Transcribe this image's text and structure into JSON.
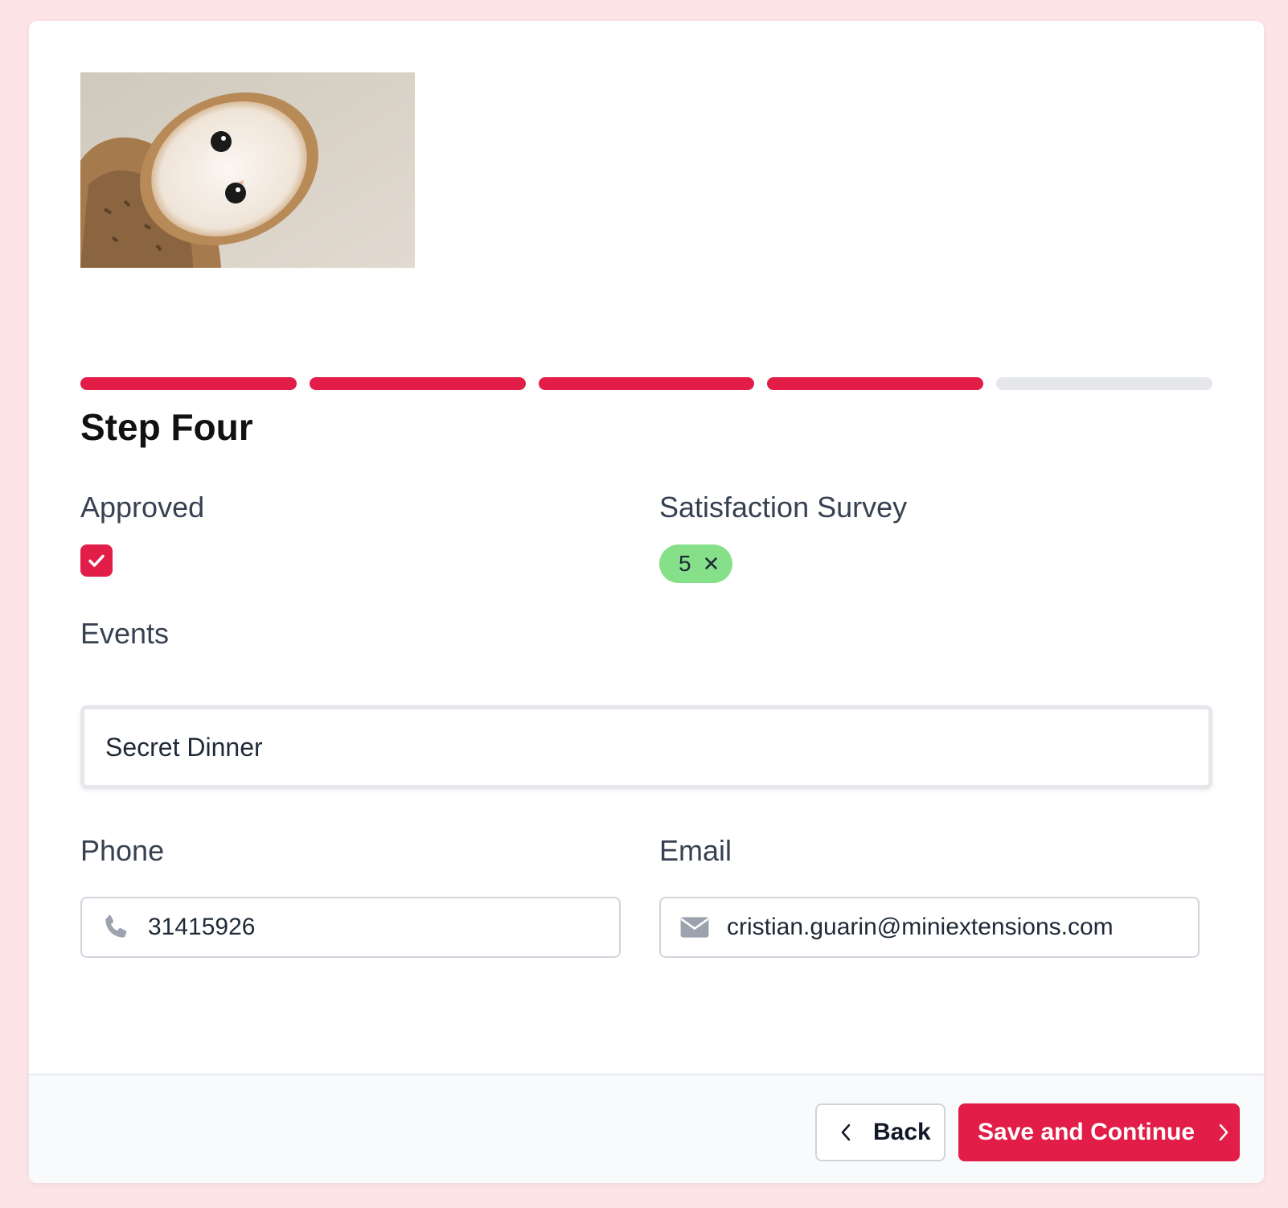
{
  "form": {
    "step_title": "Step Four",
    "progress": {
      "total_steps": 5,
      "completed_steps": 4
    },
    "approved": {
      "label": "Approved",
      "checked": true
    },
    "satisfaction": {
      "label": "Satisfaction Survey",
      "selected_value": "5"
    },
    "events": {
      "label": "Events",
      "value": "Secret Dinner"
    },
    "phone": {
      "label": "Phone",
      "value": "31415926",
      "icon": "phone-icon"
    },
    "email": {
      "label": "Email",
      "value": "cristian.guarin@miniextensions.com",
      "icon": "envelope-icon"
    }
  },
  "footer": {
    "back_label": "Back",
    "next_label": "Save and Continue"
  },
  "colors": {
    "accent": "#e11d48",
    "chip_green": "#86e08a",
    "page_background": "#fde4e6",
    "progress_inactive": "#e5e7eb"
  }
}
